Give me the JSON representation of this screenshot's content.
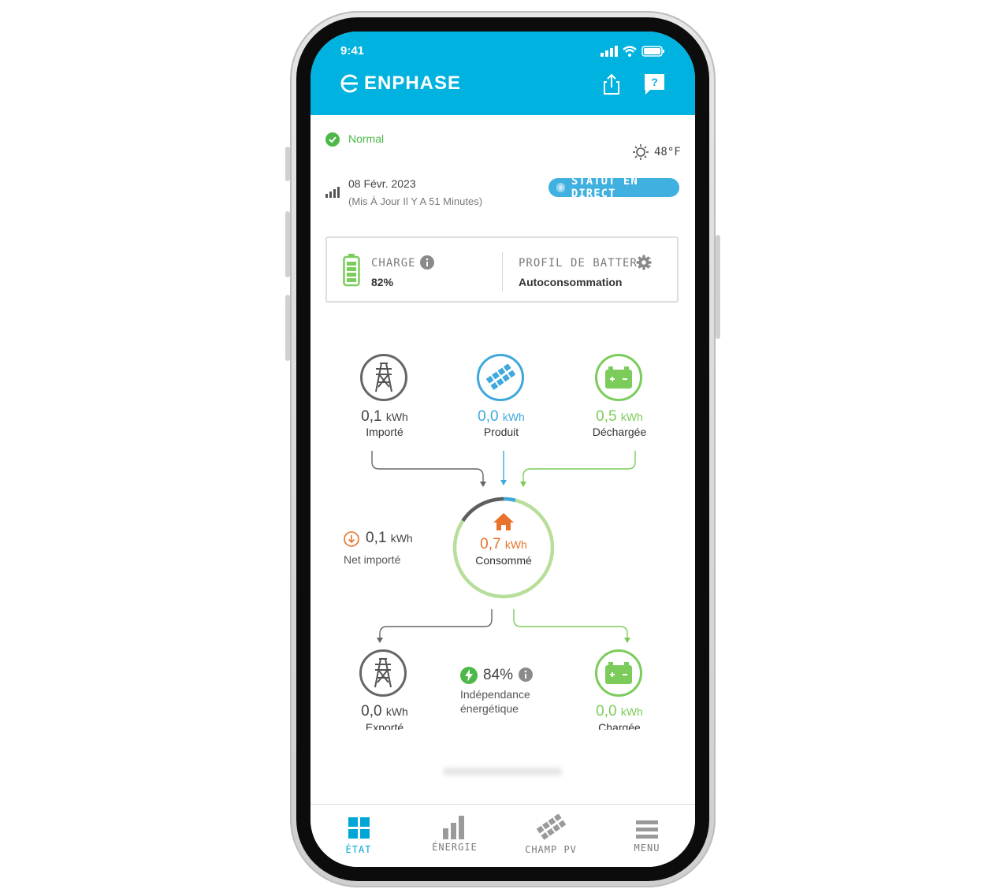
{
  "status_bar": {
    "time": "9:41"
  },
  "header": {
    "brand": "ENPHASE"
  },
  "system": {
    "status_label": "Normal",
    "temperature": "48°F",
    "date": "08 Févr. 2023",
    "updated": "(Mis À Jour Il Y A 51 Minutes)",
    "live_button": "STATUT EN DIRECT"
  },
  "battery_card": {
    "charge_label": "CHARGE",
    "charge_value": "82%",
    "profile_label": "PROFIL DE BATTERIE",
    "profile_value": "Autoconsommation"
  },
  "flow": {
    "imported": {
      "value": "0,1",
      "unit": "kWh",
      "label": "Importé"
    },
    "produced": {
      "value": "0,0",
      "unit": "kWh",
      "label": "Produit"
    },
    "discharged": {
      "value": "0,5",
      "unit": "kWh",
      "label": "Déchargée"
    },
    "net_imported": {
      "value": "0,1",
      "unit": "kWh",
      "label": "Net importé"
    },
    "consumed": {
      "value": "0,7",
      "unit": "kWh",
      "label": "Consommé"
    },
    "exported": {
      "value": "0,0",
      "unit": "kWh",
      "label": "Exporté"
    },
    "independence": {
      "value": "84%",
      "line1": "Indépendance",
      "line2": "énergétique"
    },
    "charged": {
      "value": "0,0",
      "unit": "kWh",
      "label": "Chargée"
    }
  },
  "tabs": [
    {
      "label": "ÉTAT",
      "active": true
    },
    {
      "label": "ÉNERGIE",
      "active": false
    },
    {
      "label": "CHAMP PV",
      "active": false
    },
    {
      "label": "MENU",
      "active": false
    }
  ],
  "colors": {
    "header": "#00b2df",
    "green": "#7ccc5b",
    "blue": "#3fa8dc",
    "grey": "#666666",
    "orange": "#e8722b"
  }
}
